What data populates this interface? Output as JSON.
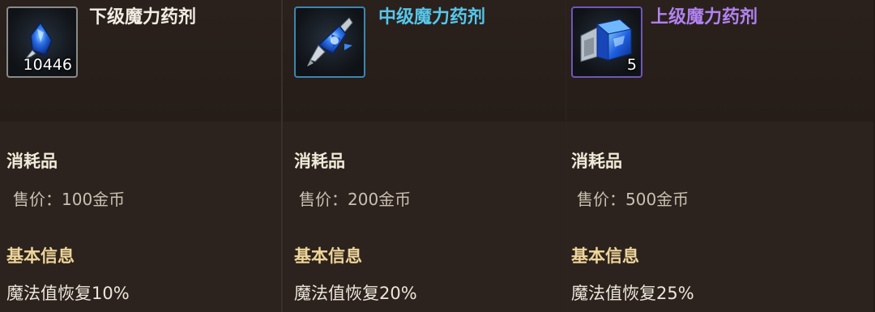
{
  "items": [
    {
      "name": "下级魔力药剂",
      "count": "10446",
      "type": "消耗品",
      "price": "售价：100金币",
      "section": "基本信息",
      "effect": "魔法值恢复10%",
      "icon": "small-mana-potion-icon",
      "name_color": "#f2ece3",
      "frame_color": "#8a8a8a"
    },
    {
      "name": "中级魔力药剂",
      "count": "",
      "type": "消耗品",
      "price": "售价：200金币",
      "section": "基本信息",
      "effect": "魔法值恢复20%",
      "icon": "medium-mana-potion-icon",
      "name_color": "#57c6ea",
      "frame_color": "#3d86b0"
    },
    {
      "name": "上级魔力药剂",
      "count": "5",
      "type": "消耗品",
      "price": "售价：500金币",
      "section": "基本信息",
      "effect": "魔法值恢复25%",
      "icon": "large-mana-potion-icon",
      "name_color": "#b182f0",
      "frame_color": "#6e58b8"
    }
  ]
}
